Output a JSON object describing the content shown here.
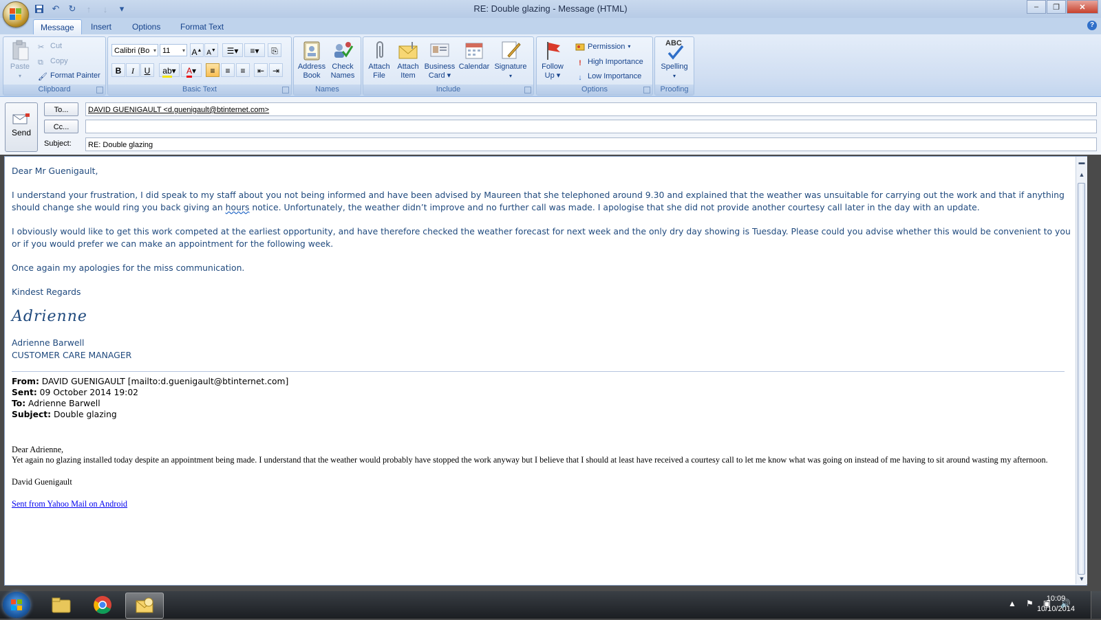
{
  "window": {
    "title": "RE: Double glazing - Message (HTML)"
  },
  "tabs": [
    "Message",
    "Insert",
    "Options",
    "Format Text"
  ],
  "ribbon": {
    "clipboard": {
      "paste": "Paste",
      "cut": "Cut",
      "copy": "Copy",
      "format_painter": "Format Painter",
      "label": "Clipboard"
    },
    "basic_text": {
      "font": "Calibri (Bo",
      "size": "11",
      "label": "Basic Text"
    },
    "names": {
      "address_book_1": "Address",
      "address_book_2": "Book",
      "check_names_1": "Check",
      "check_names_2": "Names",
      "label": "Names"
    },
    "include": {
      "attach_file_1": "Attach",
      "attach_file_2": "File",
      "attach_item_1": "Attach",
      "attach_item_2": "Item",
      "business_card_1": "Business",
      "business_card_2": "Card",
      "calendar": "Calendar",
      "signature": "Signature",
      "label": "Include"
    },
    "options": {
      "follow_up_1": "Follow",
      "follow_up_2": "Up",
      "permission": "Permission",
      "high_importance": "High Importance",
      "low_importance": "Low Importance",
      "label": "Options"
    },
    "proofing": {
      "spelling": "Spelling",
      "abc": "ABC",
      "label": "Proofing"
    }
  },
  "header": {
    "send": "Send",
    "to_button": "To...",
    "cc_button": "Cc...",
    "subject_label": "Subject:",
    "to_value": "DAVID GUENIGAULT <d.guenigault@btinternet.com>",
    "cc_value": "",
    "subject_value": "RE: Double glazing"
  },
  "body": {
    "greeting": "Dear Mr Guenigault,",
    "p1_a": "I understand your frustration, I did speak to my staff about you not being informed and have been advised by Maureen that she telephoned around 9.30  and explained that the weather was unsuitable for carrying out the work and that if anything should change she would ring you back giving an ",
    "p1_hours": "hours",
    "p1_b": " notice.  Unfortunately, the weather didn’t improve and no further call was made.  I apologise that she did not provide another courtesy call later in the day with an update.",
    "p2": "I obviously would like to get this work competed at the earliest opportunity, and  have therefore checked the weather forecast for next week and the only dry day showing is Tuesday.  Please could you advise whether this would be convenient to you or if you would prefer we can make an appointment for the following week.",
    "p3": "Once again my apologies for the miss communication.",
    "closing": "Kindest Regards",
    "signature_script": "Adrienne",
    "sig_name": "Adrienne Barwell",
    "sig_title": "CUSTOMER CARE MANAGER"
  },
  "original": {
    "from_label": "From:",
    "from_value": " DAVID GUENIGAULT [mailto:d.guenigault@btinternet.com]",
    "sent_label": "Sent:",
    "sent_value": " 09 October 2014 19:02",
    "to_label": "To:",
    "to_value": " Adrienne Barwell",
    "subject_label": "Subject:",
    "subject_value": " Double glazing",
    "greeting": "Dear Adrienne,",
    "text": "Yet again no glazing installed today despite an appointment being made. I understand that the weather would probably have stopped the work anyway but I believe that I should at least have received a courtesy call to let me know what was going on instead of me having to sit around wasting my afternoon.",
    "signoff": "David Guenigault",
    "link": "Sent from Yahoo Mail on Android"
  },
  "taskbar": {
    "time": "10:09",
    "date": "10/10/2014"
  }
}
